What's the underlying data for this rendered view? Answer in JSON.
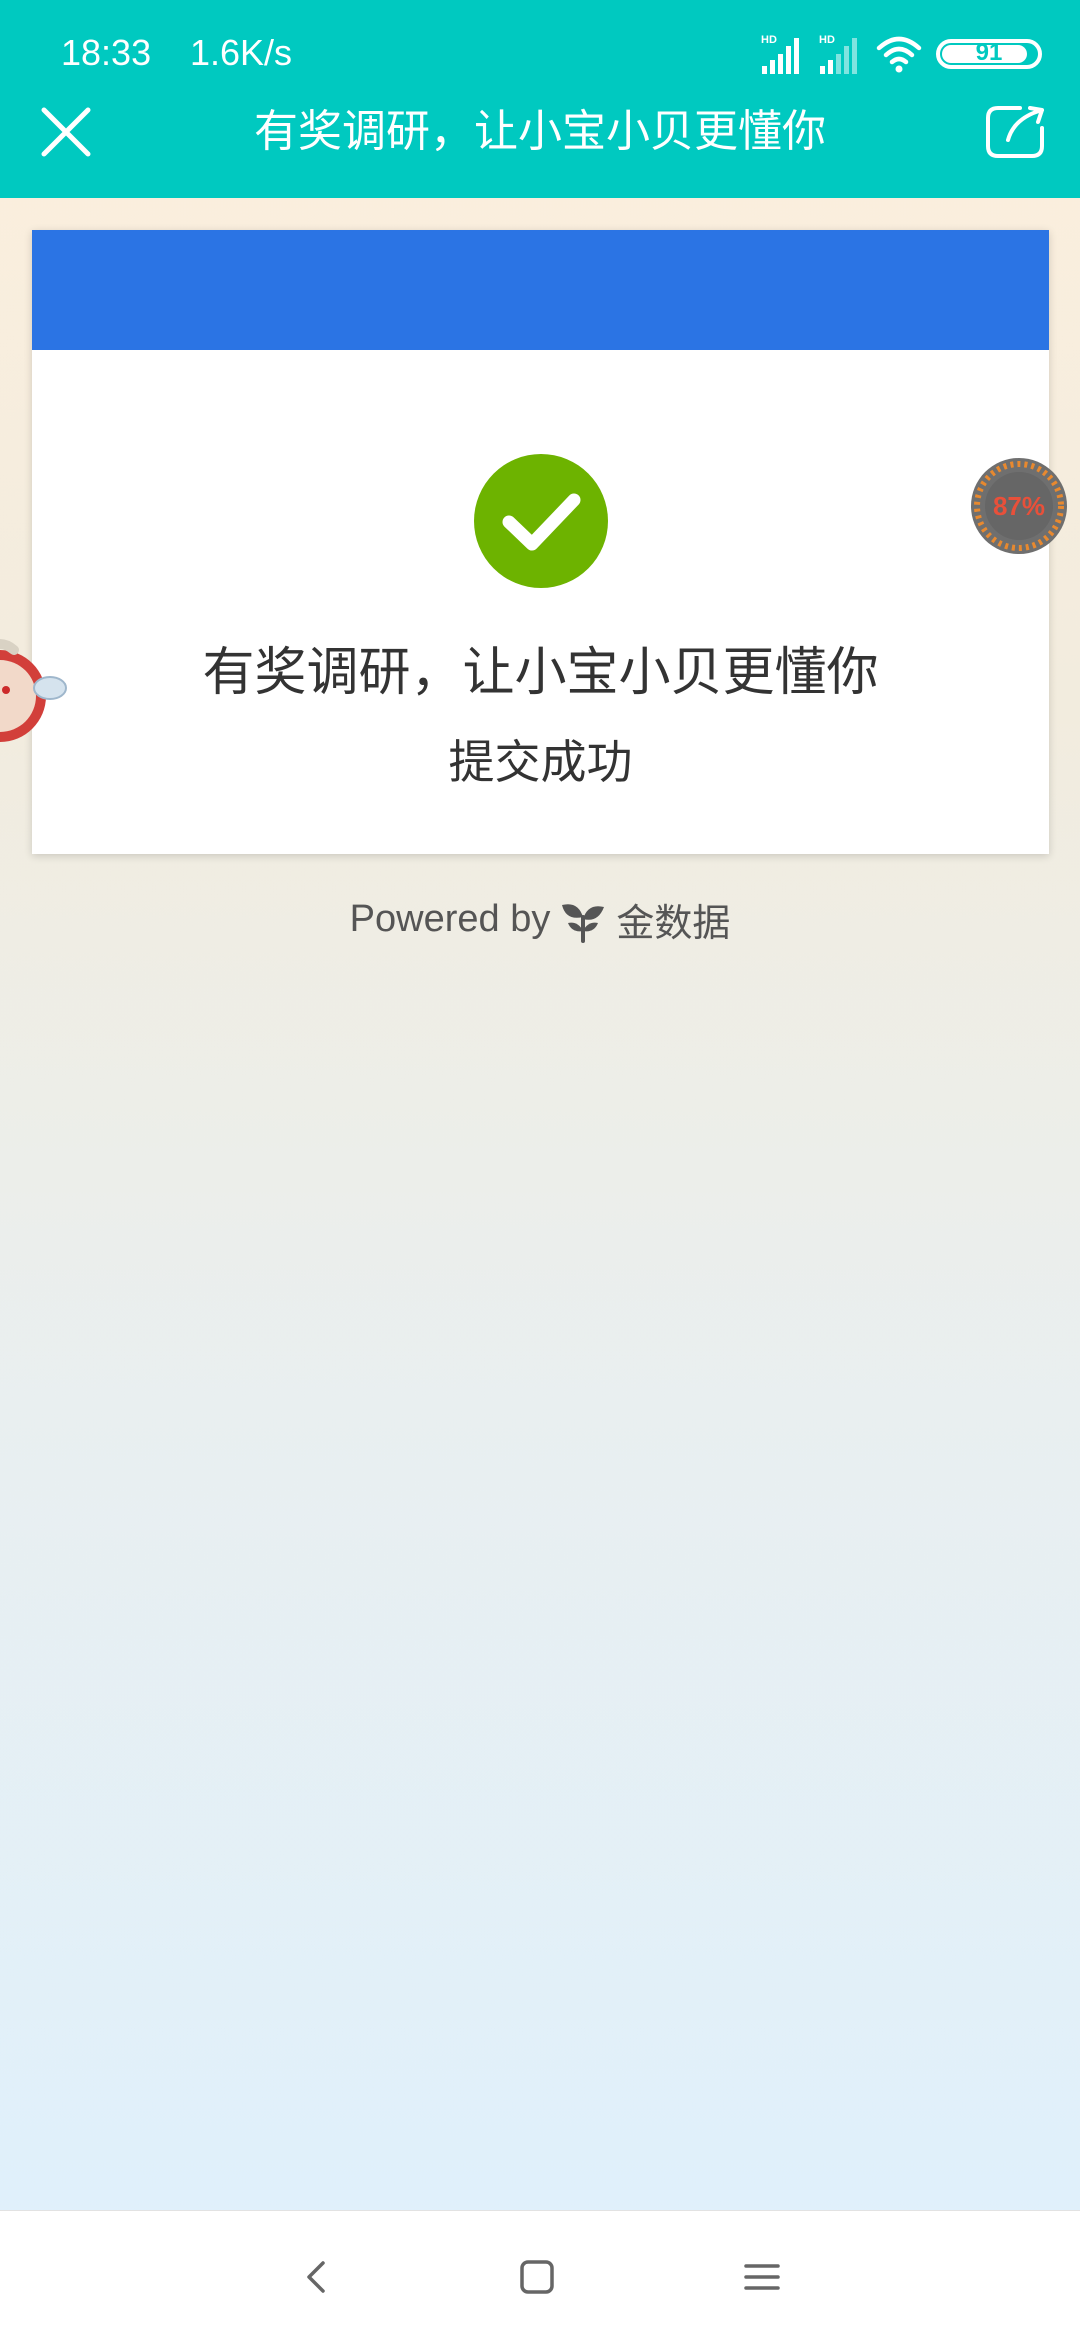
{
  "status_bar": {
    "time": "18:33",
    "net_speed": "1.6K/s",
    "battery": "91",
    "battery_fraction": 0.91,
    "icons": [
      "hd-signal-icon",
      "hd-signal-icon",
      "wifi-icon",
      "battery-icon"
    ]
  },
  "header": {
    "title": "有奖调研，让小宝小贝更懂你",
    "close_icon": "close-icon",
    "share_icon": "share-icon",
    "background": "#00c9c0"
  },
  "card": {
    "header_color": "#2b74e4",
    "check_color": "#6db300",
    "title": "有奖调研，让小宝小贝更懂你",
    "subtitle": "提交成功"
  },
  "footer": {
    "powered_by": "Powered by",
    "brand": "金数据",
    "brand_icon": "sprout-icon"
  },
  "floating": {
    "speed_percent": "87%",
    "mascot_icon": "mascot-icon"
  },
  "nav": {
    "back_icon": "back-icon",
    "home_icon": "home-icon",
    "menu_icon": "menu-icon"
  }
}
